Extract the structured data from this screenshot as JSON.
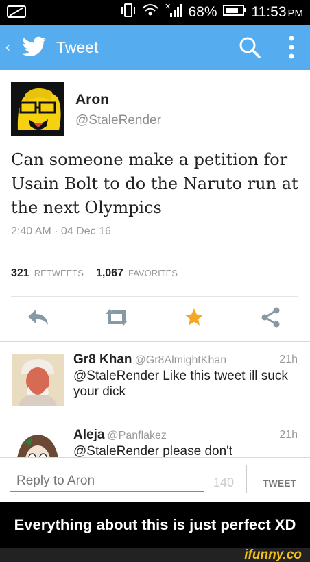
{
  "status_bar": {
    "battery": "68%",
    "time": "11:53",
    "ampm": "PM"
  },
  "app_bar": {
    "back": "‹",
    "title": "Tweet"
  },
  "tweet": {
    "author_name": "Aron",
    "author_handle": "@StaleRender",
    "text": "Can someone make a petition for Usain Bolt to do the Naruto run at the next Olympics",
    "timestamp": "2:40 AM · 04 Dec 16",
    "retweets_count": "321",
    "retweets_label": "RETWEETS",
    "favorites_count": "1,067",
    "favorites_label": "FAVORITES"
  },
  "replies": [
    {
      "name": "Gr8 Khan",
      "handle": "@Gr8AlmightKhan",
      "time": "21h",
      "text": "@StaleRender Like this tweet ill suck your dick"
    },
    {
      "name": "Aleja",
      "handle": "@Panflakez",
      "time": "21h",
      "text": "@StaleRender please don't"
    }
  ],
  "composer": {
    "placeholder": "Reply to Aron",
    "count": "140",
    "button": "TWEET"
  },
  "caption": "Everything about this is just perfect XD",
  "watermark": "ifunny.co",
  "colors": {
    "twitter_blue": "#55acee",
    "favorite_star": "#f5a623",
    "action_gray": "#8899a6"
  },
  "icons": [
    "back-chevron-icon",
    "twitter-bird-icon",
    "search-icon",
    "more-vertical-icon",
    "reply-icon",
    "retweet-icon",
    "favorite-star-icon",
    "share-icon"
  ]
}
